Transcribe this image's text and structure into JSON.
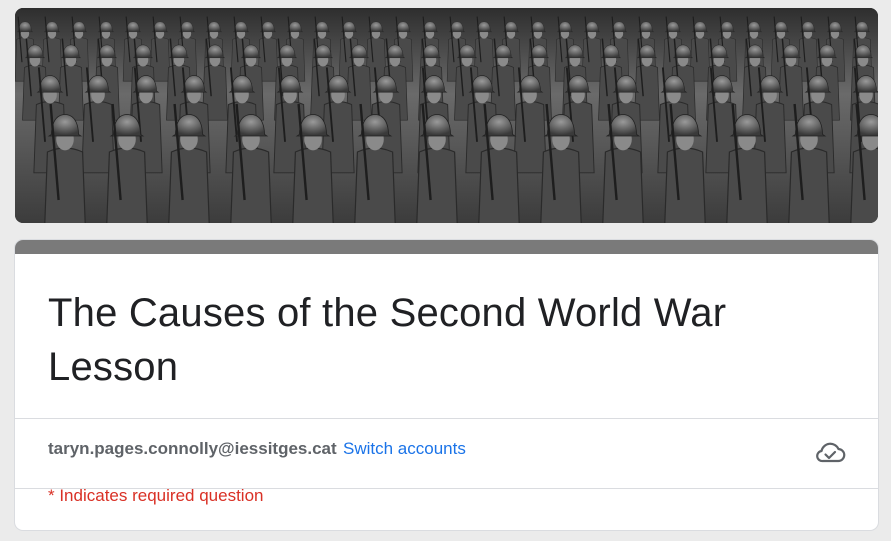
{
  "header": {
    "image_description_icon": "soldiers-marching-photo"
  },
  "form": {
    "title": "The Causes of the Second World War Lesson",
    "account_email": "taryn.pages.connolly@iessitges.cat",
    "switch_accounts_label": "Switch accounts",
    "saved_icon": "cloud-check-icon",
    "required_note": "* Indicates required question"
  },
  "colors": {
    "background": "#ebebeb",
    "card_accent": "#7a7a7a",
    "link": "#1a73e8",
    "required": "#d93025"
  }
}
